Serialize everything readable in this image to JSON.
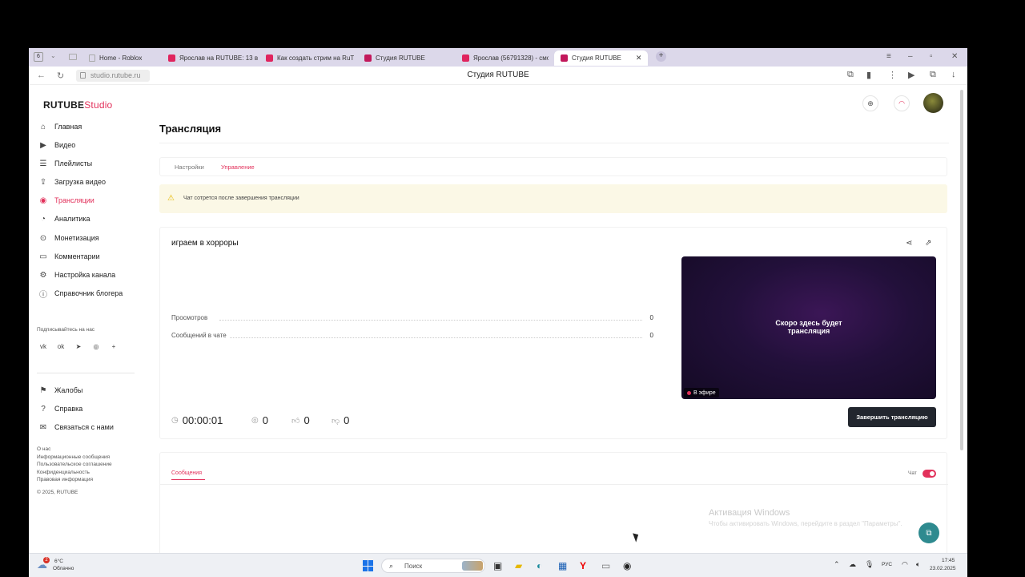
{
  "browser": {
    "workspace_badge": "6",
    "tabs": [
      {
        "label": "Home - Roblox",
        "active": false
      },
      {
        "label": "Ярослав на RUTUBE: 13 в",
        "active": false
      },
      {
        "label": "Как создать стрим на RuT",
        "active": false
      },
      {
        "label": "Студия RUTUBE",
        "active": false
      },
      {
        "label": "Ярослав (56791328) - смо",
        "active": false
      },
      {
        "label": "Студия RUTUBE",
        "active": true
      }
    ],
    "new_tab": "+",
    "url": "studio.rutube.ru",
    "page_title": "Студия RUTUBE"
  },
  "app": {
    "logo_main": "RUTUBE",
    "logo_studio": "Studio",
    "sidebar": {
      "items": [
        {
          "label": "Главная",
          "icon": "home-icon",
          "glyph": "⌂"
        },
        {
          "label": "Видео",
          "icon": "video-icon",
          "glyph": "▶"
        },
        {
          "label": "Плейлисты",
          "icon": "playlist-icon",
          "glyph": "☰"
        },
        {
          "label": "Загрузка видео",
          "icon": "upload-icon",
          "glyph": "⇪"
        },
        {
          "label": "Трансляции",
          "icon": "broadcast-icon",
          "glyph": "◉",
          "active": true
        },
        {
          "label": "Аналитика",
          "icon": "analytics-icon",
          "glyph": "◔"
        },
        {
          "label": "Монетизация",
          "icon": "money-icon",
          "glyph": "⊙"
        },
        {
          "label": "Комментарии",
          "icon": "comments-icon",
          "glyph": "▭"
        },
        {
          "label": "Настройка канала",
          "icon": "settings-icon",
          "glyph": "⚙"
        },
        {
          "label": "Справочник блогера",
          "icon": "info-icon",
          "glyph": "ⓘ"
        }
      ],
      "subscribe_label": "Подписывайтесь на нас",
      "socials": [
        "vk-icon",
        "ok-icon",
        "telegram-icon",
        "dzen-icon",
        "plus-icon"
      ],
      "bottom_items": [
        {
          "label": "Жалобы",
          "icon": "flag-icon",
          "glyph": "⚑"
        },
        {
          "label": "Справка",
          "icon": "help-icon",
          "glyph": "?"
        },
        {
          "label": "Связаться с нами",
          "icon": "mail-icon",
          "glyph": "✉"
        }
      ],
      "footer_links": [
        "О нас",
        "Информационные сообщения",
        "Пользовательское соглашение",
        "Конфиденциальность",
        "Правовая информация"
      ],
      "copyright": "© 2025, RUTUBE"
    },
    "header": {
      "upload_icon": "upload-icon",
      "bell_icon": "bell-icon"
    },
    "main": {
      "title": "Трансляция",
      "tabs": [
        {
          "label": "Настройки",
          "active": false
        },
        {
          "label": "Управление",
          "active": true
        }
      ],
      "notice": "Чат сотрется после завершения трансляции",
      "stream": {
        "title": "играем в хорроры",
        "stats": [
          {
            "label": "Просмотров",
            "value": "0"
          },
          {
            "label": "Сообщений в чате",
            "value": "0"
          }
        ],
        "preview_text_line1": "Скоро здесь будет",
        "preview_text_line2": "трансляция",
        "live_label": "В эфире",
        "timer": "00:00:01",
        "viewers": "0",
        "likes": "0",
        "dislikes": "0",
        "end_button": "Завершить трансляцию"
      },
      "chat": {
        "tab": "Сообщения",
        "toggle_label": "Чат",
        "toggle_on": true
      }
    }
  },
  "overlay": {
    "activation_title": "Активация Windows",
    "activation_sub": "Чтобы активировать Windows, перейдите в раздел \"Параметры\"."
  },
  "taskbar": {
    "weather_badge": "2",
    "weather_temp": "6°C",
    "weather_desc": "Облачно",
    "search_placeholder": "Поиск",
    "language": "РУС",
    "time": "17:45",
    "date": "23.02.2025"
  },
  "colors": {
    "accent": "#e2315b",
    "end_button_bg": "#22262e",
    "notice_bg": "#fbf8e6"
  }
}
